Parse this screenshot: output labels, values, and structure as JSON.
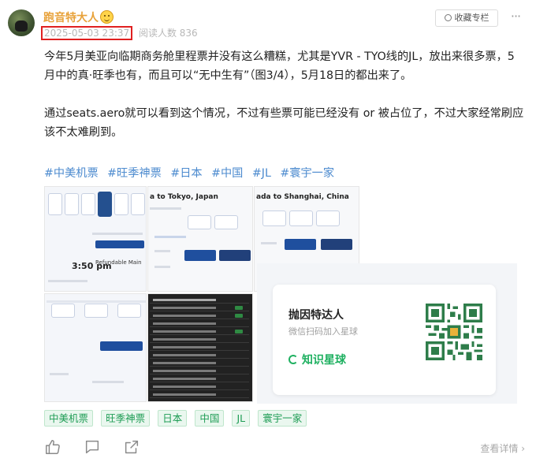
{
  "post": {
    "author": "跑音特大人",
    "date": "2025-05-03 23:37",
    "readers": "阅读人数 836",
    "collect_label": "收藏专栏",
    "more_label": "···",
    "paragraphs": [
      "今年5月美亚向临期商务舱里程票并没有这么糟糕，尤其是YVR - TYO线的JL，放出来很多票，5月中的真·旺季也有，而且可以“无中生有”（图3/4），5月18日的都出来了。",
      "通过seats.aero就可以看到这个情况，不过有些票可能已经没有 or 被占位了，不过大家经常刷应该不太难刷到。"
    ],
    "hashtags": [
      "#中美机票",
      "#旺季神票",
      "#日本",
      "#中国",
      "#JL",
      "#寰宇一家"
    ],
    "tags": [
      "中美机票",
      "旺季神票",
      "日本",
      "中国",
      "JL",
      "寰宇一家"
    ],
    "view_detail": "查看详情 ›"
  },
  "images": {
    "img1_time": "3:50 pm",
    "img1_label": "Refundable Main",
    "img2_title": "a to Tokyo, Japan",
    "img3_title": "ada to Shanghai, China"
  },
  "promo": {
    "name": "抛因特达人",
    "subtitle": "微信扫码加入星球",
    "brand": "知识星球"
  },
  "icons": {
    "like": "thumbs-up-icon",
    "comment": "comment-icon",
    "share": "share-icon"
  },
  "colors": {
    "author": "#e8a23a",
    "hashtag": "#4d8bcf",
    "tag": "#1f9d55",
    "highlight": "#e02020",
    "brand": "#1eb060"
  }
}
